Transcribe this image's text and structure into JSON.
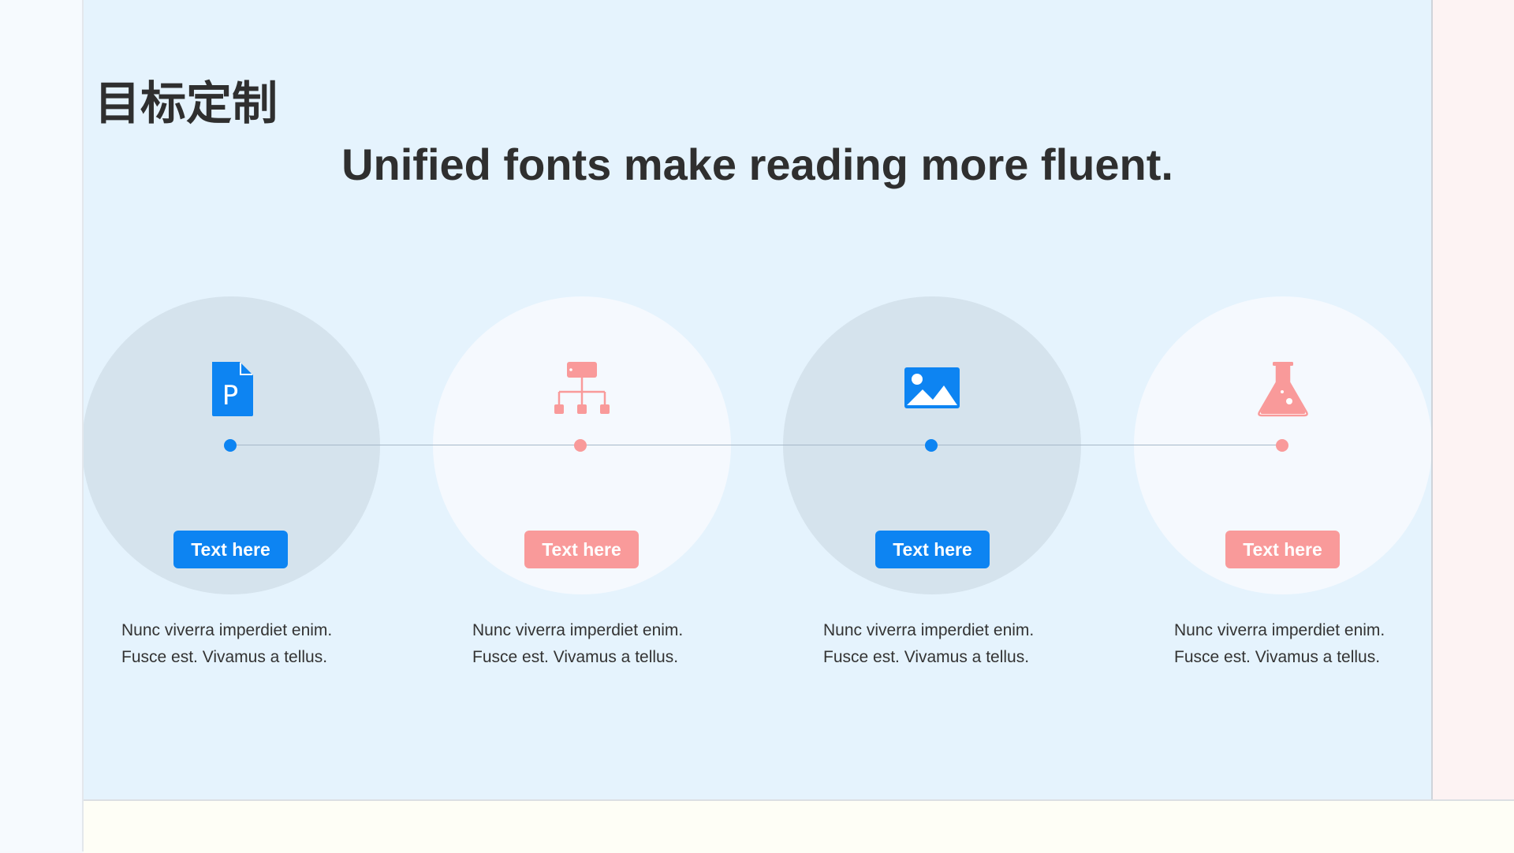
{
  "slide": {
    "heading": "目标定制",
    "subtitle": "Unified fonts make reading more fluent."
  },
  "colors": {
    "blue_accent": "#0d84f2",
    "pink_accent": "#f99a9a",
    "slide_background": "#e5f3fd",
    "text_dark": "#2f2f2f"
  },
  "steps": [
    {
      "icon": "document-p-icon",
      "label": "Text here",
      "line1": "Nunc viverra imperdiet enim.",
      "line2": "Fusce est. Vivamus a tellus.",
      "theme": "blue"
    },
    {
      "icon": "hierarchy-icon",
      "label": "Text here",
      "line1": "Nunc viverra imperdiet enim.",
      "line2": "Fusce est. Vivamus a tellus.",
      "theme": "pink"
    },
    {
      "icon": "image-icon",
      "label": "Text here",
      "line1": "Nunc viverra imperdiet enim.",
      "line2": "Fusce est. Vivamus a tellus.",
      "theme": "blue"
    },
    {
      "icon": "flask-icon",
      "label": "Text here",
      "line1": "Nunc viverra imperdiet enim.",
      "line2": "Fusce est. Vivamus a tellus.",
      "theme": "pink"
    }
  ]
}
